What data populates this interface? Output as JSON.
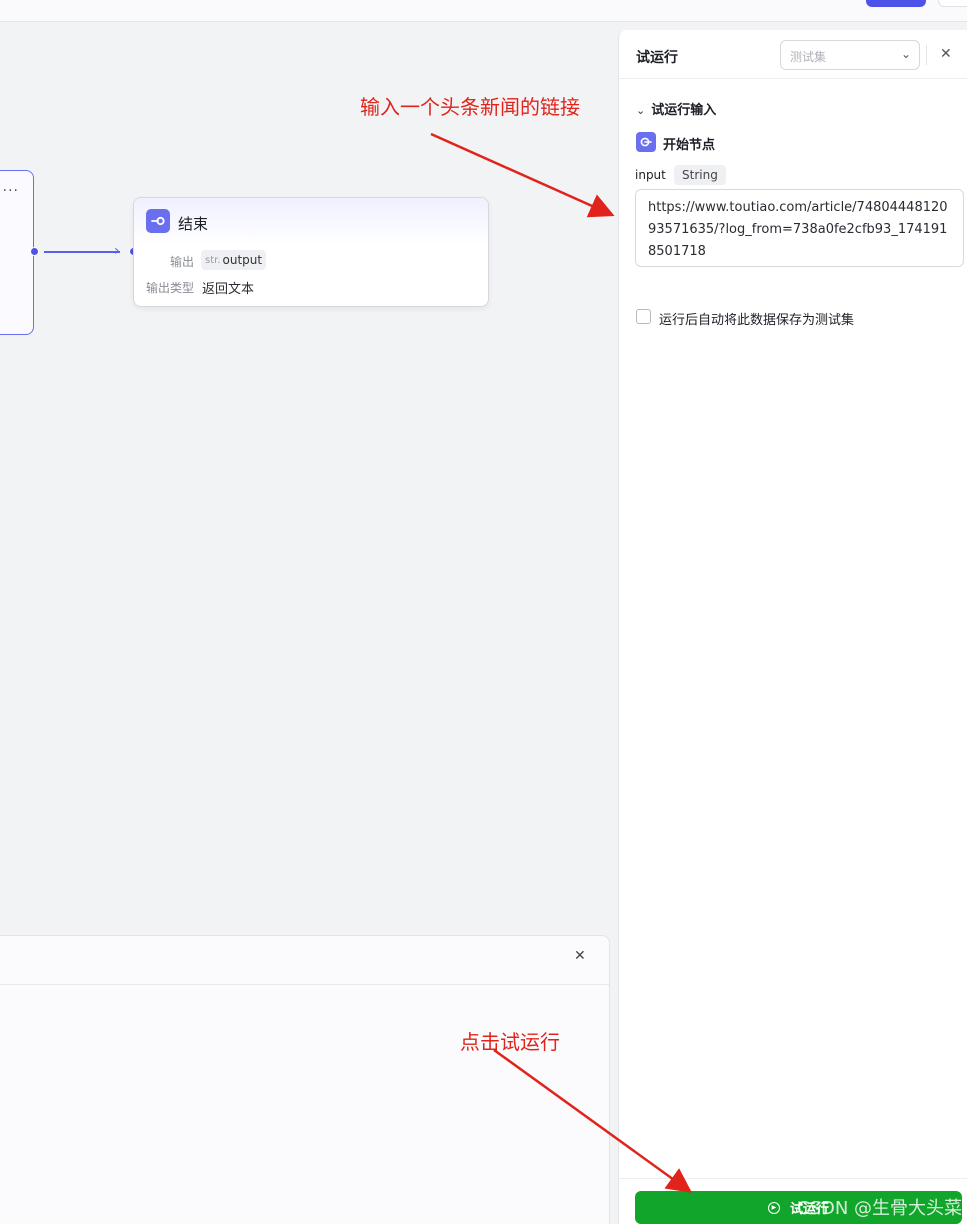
{
  "canvas": {
    "prev_node": {
      "more": "···"
    },
    "end_node": {
      "title": "结束",
      "output_label": "输出",
      "output_type_prefix": "str.",
      "output_var": "output",
      "output_type_label": "输出类型",
      "output_type_value": "返回文本"
    }
  },
  "annotations": {
    "input_hint": "输入一个头条新闻的链接",
    "run_hint": "点击试运行"
  },
  "test_panel": {
    "title": "试运行",
    "testset_placeholder": "测试集",
    "section_title": "试运行输入",
    "start_node_label": "开始节点",
    "field_name": "input",
    "field_type": "String",
    "field_value": "https://www.toutiao.com/article/7480444812093571635/?log_from=738a0fe2cfb93_1741918501718",
    "save_checkbox_label": "运行后自动将此数据保存为测试集",
    "run_button_label": "试运行"
  },
  "watermark": "CSDN @生骨大头菜",
  "colors": {
    "accent": "#4d53e8",
    "run_green": "#12a52b",
    "annotation_red": "#e0241b"
  }
}
